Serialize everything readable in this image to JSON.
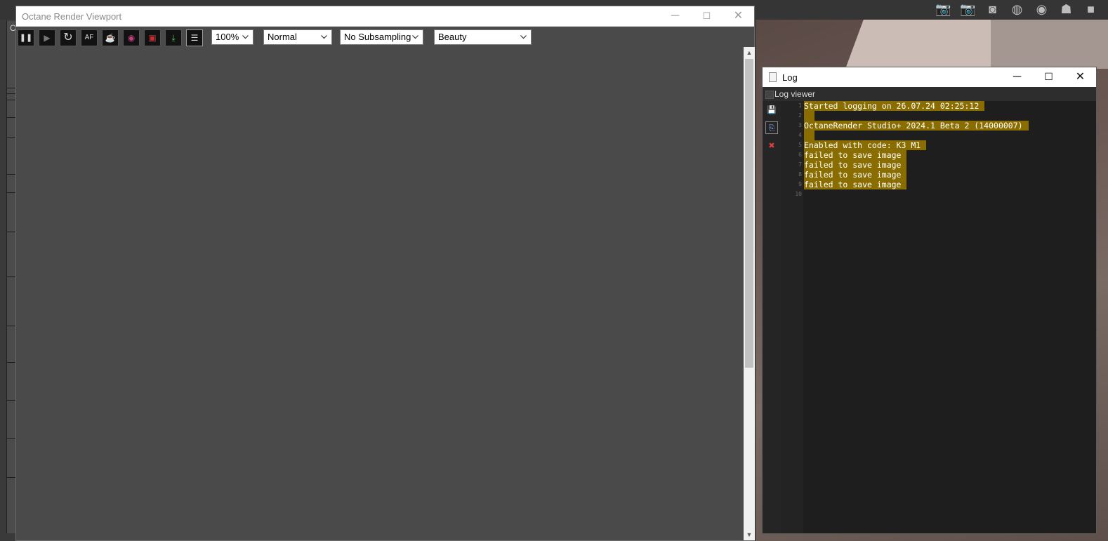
{
  "viewport_window": {
    "title": "Octane Render Viewport",
    "minimize_icon": "minimize-icon",
    "maximize_icon": "maximize-icon",
    "close_icon": "close-icon",
    "toolbar": {
      "buttons": [
        {
          "name": "pause-button",
          "glyph": "❚❚"
        },
        {
          "name": "start-button",
          "glyph": "▶"
        },
        {
          "name": "restart-button",
          "glyph": "↻"
        },
        {
          "name": "autofocus-button",
          "glyph": "AF"
        },
        {
          "name": "teapot-button",
          "glyph": "☕"
        },
        {
          "name": "color-button",
          "glyph": "◉"
        },
        {
          "name": "region-render-button",
          "glyph": "▣"
        },
        {
          "name": "save-render-button",
          "glyph": "⤓"
        },
        {
          "name": "log-button",
          "glyph": "☰"
        }
      ],
      "zoom_value": "100%",
      "mode_value": "Normal",
      "subsampling_value": "No Subsampling",
      "pass_value": "Beauty"
    }
  },
  "log_window": {
    "title": "Log",
    "subheader": "Log viewer",
    "tools": [
      "save-log-icon",
      "copy-log-icon",
      "clear-log-icon"
    ],
    "line_numbers": [
      "1",
      "2",
      "3",
      "4",
      "5",
      "6",
      "7",
      "8",
      "9",
      "10"
    ],
    "lines": [
      "Started logging on 26.07.24 02:25:12",
      "",
      "OctaneRender Studio+ 2024.1 Beta 2 (14000007)",
      "",
      "Enabled with code: K3 M1",
      "failed to save image",
      "failed to save image",
      "failed to save image",
      "failed to save image",
      ""
    ],
    "highlight_color": "#8a6d00"
  },
  "host_app": {
    "left_panel_letter": "C",
    "toolbar_icons": [
      "camera-icon",
      "camera-add-icon",
      "camera-frame-icon",
      "camera-orbit-icon",
      "lens-icon",
      "camera-rig-icon",
      "video-camera-icon"
    ]
  }
}
